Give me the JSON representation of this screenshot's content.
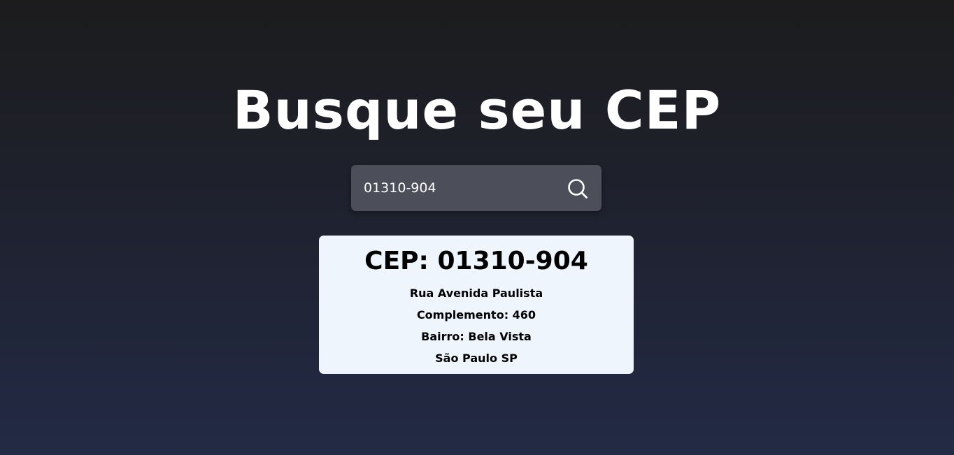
{
  "header": {
    "title": "Busque seu CEP"
  },
  "search": {
    "value": "01310-904",
    "placeholder": "",
    "button_icon": "search-icon"
  },
  "result": {
    "cep_label": "CEP: 01310-904",
    "street": "Rua Avenida Paulista",
    "complement": "Complemento: 460",
    "neighborhood": "Bairro: Bela Vista",
    "city_state": "São Paulo SP"
  },
  "colors": {
    "background_top": "#1c1c1d",
    "background_bottom": "#222a45",
    "search_box": "#4c4f59",
    "card": "#eef5fd",
    "text_light": "#ffffff",
    "text_dark": "#000000"
  }
}
